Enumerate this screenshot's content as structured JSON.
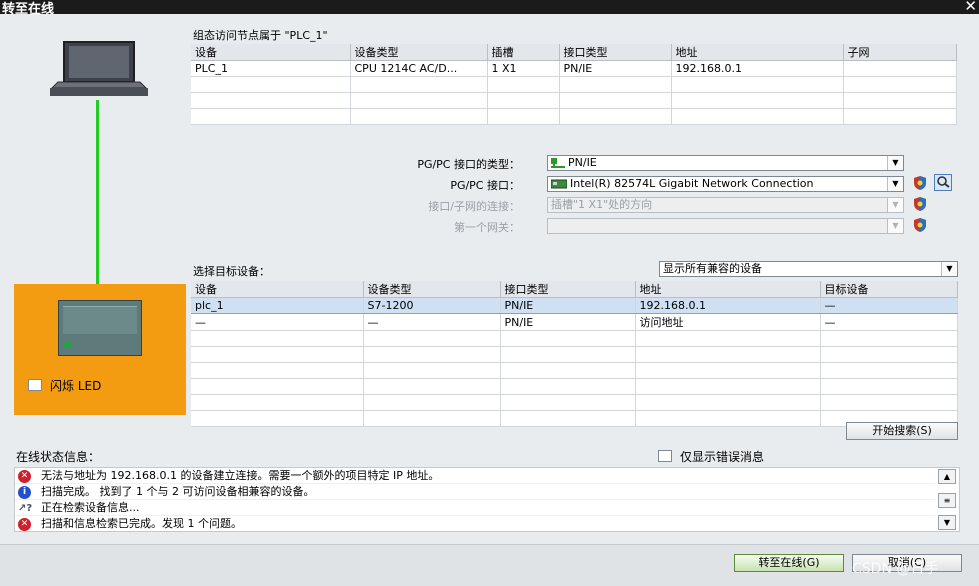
{
  "window": {
    "title": "转至在线",
    "close": "✕"
  },
  "top": {
    "caption": "组态访问节点属于 \"PLC_1\"",
    "columns": [
      "设备",
      "设备类型",
      "插槽",
      "接口类型",
      "地址",
      "子网"
    ],
    "rows": [
      [
        "PLC_1",
        "CPU 1214C AC/D...",
        "1 X1",
        "PN/IE",
        "192.168.0.1",
        ""
      ]
    ]
  },
  "interface": {
    "type_label": "PG/PC 接口的类型：",
    "type_value": "PN/IE",
    "iface_label": "PG/PC 接口：",
    "iface_value": "Intel(R) 82574L Gigabit Network Connection",
    "conn_label": "接口/子网的连接：",
    "conn_value": "插槽\"1 X1\"处的方向",
    "gateway_label": "第一个网关：",
    "gateway_value": ""
  },
  "target": {
    "caption": "选择目标设备：",
    "filter_value": "显示所有兼容的设备",
    "columns": [
      "设备",
      "设备类型",
      "接口类型",
      "地址",
      "目标设备"
    ],
    "rows": [
      [
        "plc_1",
        "S7-1200",
        "PN/IE",
        "192.168.0.1",
        "—"
      ],
      [
        "—",
        "—",
        "PN/IE",
        "访问地址",
        "—"
      ]
    ]
  },
  "device": {
    "flash_led_label": "闪烁 LED"
  },
  "search_button": "开始搜索(S)",
  "status": {
    "caption": "在线状态信息：",
    "errors_only_label": "仅显示错误消息",
    "messages": [
      {
        "type": "error",
        "text": "无法与地址为 192.168.0.1 的设备建立连接。需要一个额外的项目特定 IP 地址。"
      },
      {
        "type": "info",
        "text": "扫描完成。 找到了 1 个与 2 可访问设备相兼容的设备。"
      },
      {
        "type": "busy",
        "text": "正在检索设备信息..."
      },
      {
        "type": "error",
        "text": "扫描和信息检索已完成。发现 1 个问题。"
      }
    ]
  },
  "buttons": {
    "go_online": "转至在线(G)",
    "cancel": "取消(C)"
  },
  "watermark": "CSDN @日手",
  "colors": {
    "accent_orange": "#f39c12",
    "link_green": "#22cc22",
    "error": "#d21f2b",
    "info": "#2250c8"
  }
}
